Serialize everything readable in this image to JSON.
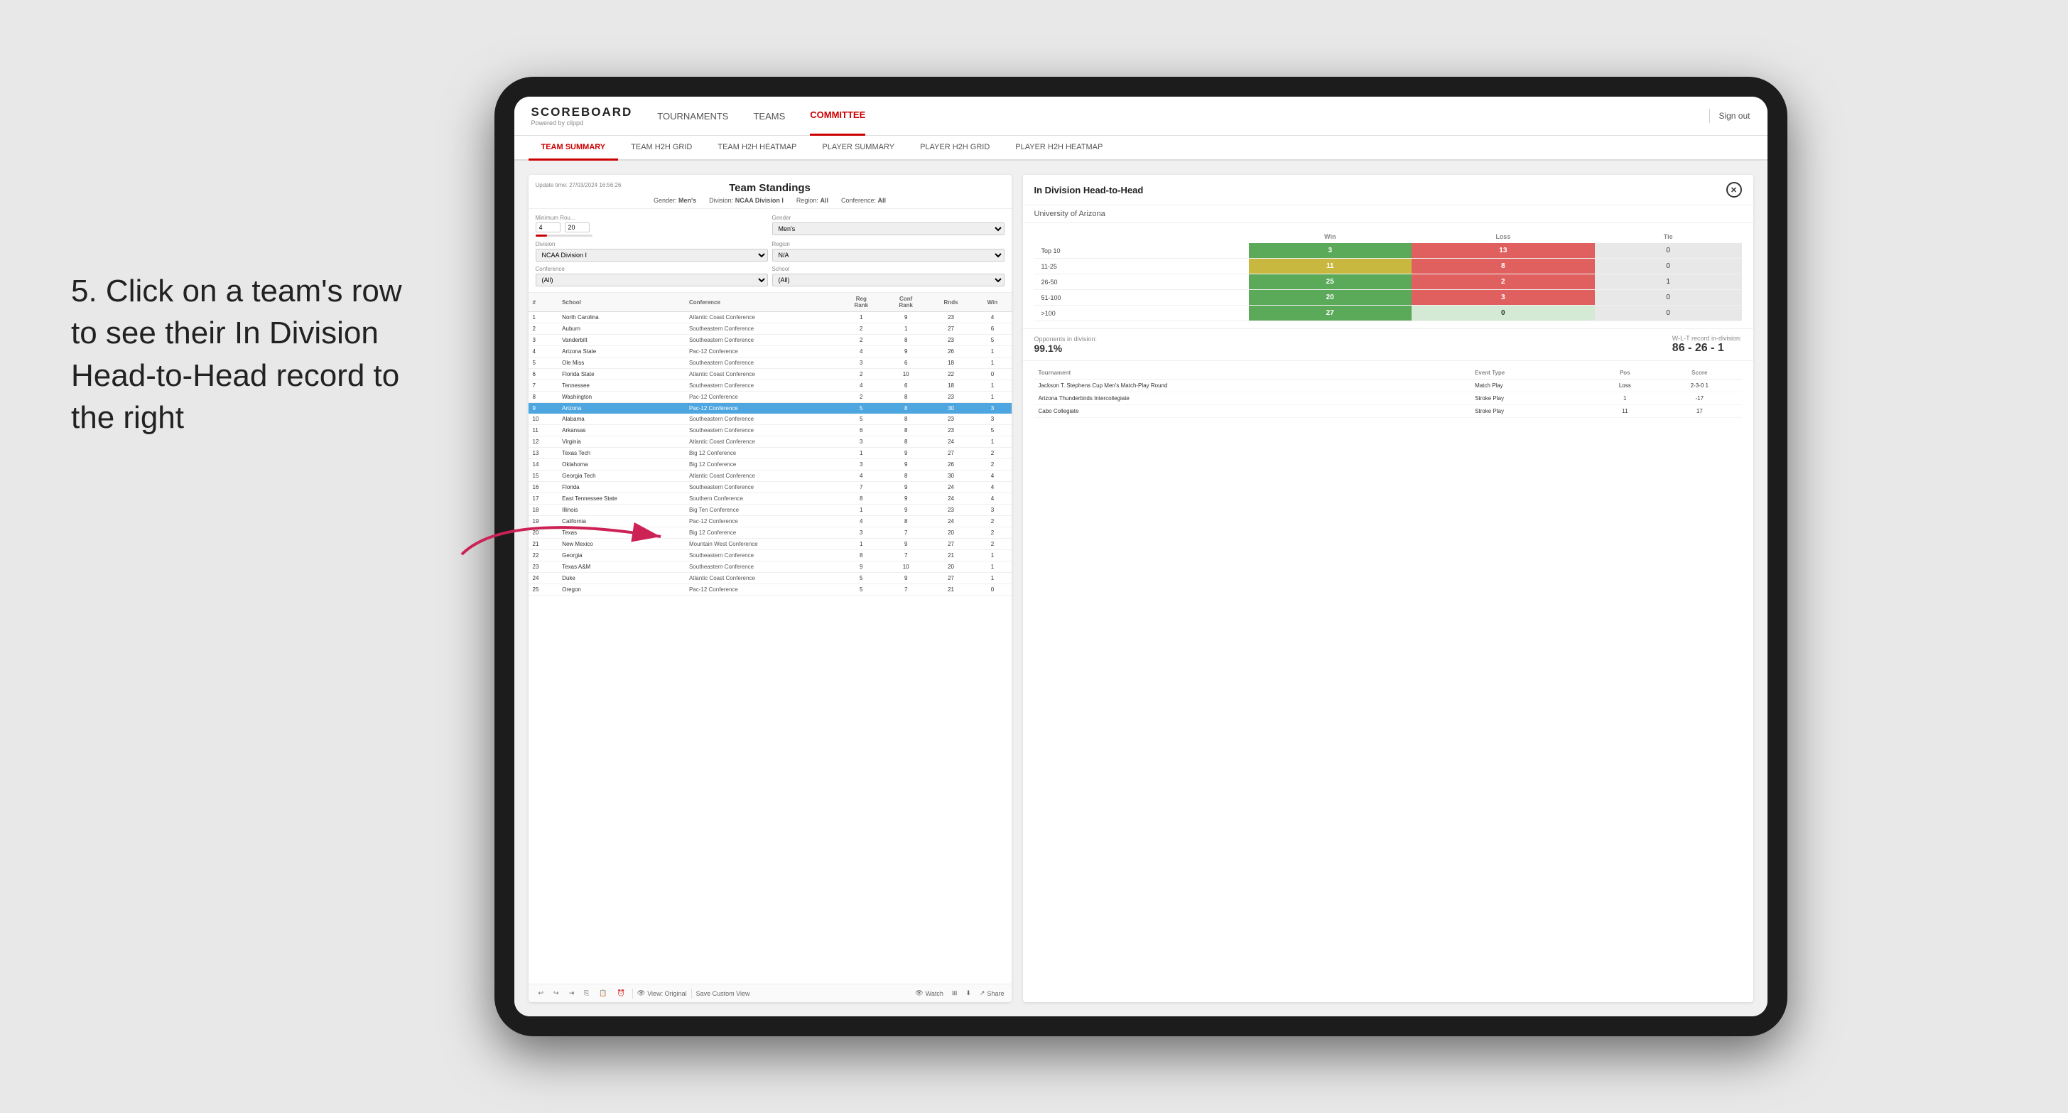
{
  "app": {
    "logo": "SCOREBOARD",
    "logo_sub": "Powered by clippd",
    "sign_out": "Sign out"
  },
  "nav": {
    "items": [
      {
        "label": "TOURNAMENTS",
        "active": false
      },
      {
        "label": "TEAMS",
        "active": false
      },
      {
        "label": "COMMITTEE",
        "active": true
      }
    ]
  },
  "sub_nav": {
    "items": [
      {
        "label": "TEAM SUMMARY",
        "active": true
      },
      {
        "label": "TEAM H2H GRID",
        "active": false
      },
      {
        "label": "TEAM H2H HEATMAP",
        "active": false
      },
      {
        "label": "PLAYER SUMMARY",
        "active": false
      },
      {
        "label": "PLAYER H2H GRID",
        "active": false
      },
      {
        "label": "PLAYER H2H HEATMAP",
        "active": false
      }
    ]
  },
  "annotation": "5. Click on a team's row to see their In Division Head-to-Head record to the right",
  "standings": {
    "title": "Team Standings",
    "update_time": "Update time: 27/03/2024 16:56:26",
    "gender_label": "Gender:",
    "gender_value": "Men's",
    "division_label": "Division:",
    "division_value": "NCAA Division I",
    "region_label": "Region:",
    "region_value": "All",
    "conference_label": "Conference:",
    "conference_value": "All",
    "min_rounds_label": "Minimum Rou...",
    "min_rounds_value": "4",
    "min_rounds_max": "20",
    "gender_filter": "Men's",
    "division_filter": "NCAA Division I",
    "region_filter": "N/A",
    "conference_filter": "(All)",
    "school_filter": "(All)",
    "columns": [
      "#",
      "School",
      "Conference",
      "Reg Rank",
      "Conf Rank",
      "Rnds",
      "Win"
    ],
    "rows": [
      {
        "num": 1,
        "school": "North Carolina",
        "conference": "Atlantic Coast Conference",
        "reg_rank": 1,
        "conf_rank": 9,
        "rnds": 23,
        "win": 4
      },
      {
        "num": 2,
        "school": "Auburn",
        "conference": "Southeastern Conference",
        "reg_rank": 2,
        "conf_rank": 1,
        "rnds": 27,
        "win": 6
      },
      {
        "num": 3,
        "school": "Vanderbilt",
        "conference": "Southeastern Conference",
        "reg_rank": 2,
        "conf_rank": 8,
        "rnds": 23,
        "win": 5
      },
      {
        "num": 4,
        "school": "Arizona State",
        "conference": "Pac-12 Conference",
        "reg_rank": 4,
        "conf_rank": 9,
        "rnds": 26,
        "win": 1
      },
      {
        "num": 5,
        "school": "Ole Miss",
        "conference": "Southeastern Conference",
        "reg_rank": 3,
        "conf_rank": 6,
        "rnds": 18,
        "win": 1
      },
      {
        "num": 6,
        "school": "Florida State",
        "conference": "Atlantic Coast Conference",
        "reg_rank": 2,
        "conf_rank": 10,
        "rnds": 22,
        "win": 0
      },
      {
        "num": 7,
        "school": "Tennessee",
        "conference": "Southeastern Conference",
        "reg_rank": 4,
        "conf_rank": 6,
        "rnds": 18,
        "win": 1
      },
      {
        "num": 8,
        "school": "Washington",
        "conference": "Pac-12 Conference",
        "reg_rank": 2,
        "conf_rank": 8,
        "rnds": 23,
        "win": 1
      },
      {
        "num": 9,
        "school": "Arizona",
        "conference": "Pac-12 Conference",
        "reg_rank": 5,
        "conf_rank": 8,
        "rnds": 30,
        "win": 3,
        "highlighted": true
      },
      {
        "num": 10,
        "school": "Alabama",
        "conference": "Southeastern Conference",
        "reg_rank": 5,
        "conf_rank": 8,
        "rnds": 23,
        "win": 3
      },
      {
        "num": 11,
        "school": "Arkansas",
        "conference": "Southeastern Conference",
        "reg_rank": 6,
        "conf_rank": 8,
        "rnds": 23,
        "win": 5
      },
      {
        "num": 12,
        "school": "Virginia",
        "conference": "Atlantic Coast Conference",
        "reg_rank": 3,
        "conf_rank": 8,
        "rnds": 24,
        "win": 1
      },
      {
        "num": 13,
        "school": "Texas Tech",
        "conference": "Big 12 Conference",
        "reg_rank": 1,
        "conf_rank": 9,
        "rnds": 27,
        "win": 2
      },
      {
        "num": 14,
        "school": "Oklahoma",
        "conference": "Big 12 Conference",
        "reg_rank": 3,
        "conf_rank": 9,
        "rnds": 26,
        "win": 2
      },
      {
        "num": 15,
        "school": "Georgia Tech",
        "conference": "Atlantic Coast Conference",
        "reg_rank": 4,
        "conf_rank": 8,
        "rnds": 30,
        "win": 4
      },
      {
        "num": 16,
        "school": "Florida",
        "conference": "Southeastern Conference",
        "reg_rank": 7,
        "conf_rank": 9,
        "rnds": 24,
        "win": 4
      },
      {
        "num": 17,
        "school": "East Tennessee State",
        "conference": "Southern Conference",
        "reg_rank": 8,
        "conf_rank": 9,
        "rnds": 24,
        "win": 4
      },
      {
        "num": 18,
        "school": "Illinois",
        "conference": "Big Ten Conference",
        "reg_rank": 1,
        "conf_rank": 9,
        "rnds": 23,
        "win": 3
      },
      {
        "num": 19,
        "school": "California",
        "conference": "Pac-12 Conference",
        "reg_rank": 4,
        "conf_rank": 8,
        "rnds": 24,
        "win": 2
      },
      {
        "num": 20,
        "school": "Texas",
        "conference": "Big 12 Conference",
        "reg_rank": 3,
        "conf_rank": 7,
        "rnds": 20,
        "win": 2
      },
      {
        "num": 21,
        "school": "New Mexico",
        "conference": "Mountain West Conference",
        "reg_rank": 1,
        "conf_rank": 9,
        "rnds": 27,
        "win": 2
      },
      {
        "num": 22,
        "school": "Georgia",
        "conference": "Southeastern Conference",
        "reg_rank": 8,
        "conf_rank": 7,
        "rnds": 21,
        "win": 1
      },
      {
        "num": 23,
        "school": "Texas A&M",
        "conference": "Southeastern Conference",
        "reg_rank": 9,
        "conf_rank": 10,
        "rnds": 20,
        "win": 1
      },
      {
        "num": 24,
        "school": "Duke",
        "conference": "Atlantic Coast Conference",
        "reg_rank": 5,
        "conf_rank": 9,
        "rnds": 27,
        "win": 1
      },
      {
        "num": 25,
        "school": "Oregon",
        "conference": "Pac-12 Conference",
        "reg_rank": 5,
        "conf_rank": 7,
        "rnds": 21,
        "win": 0
      }
    ]
  },
  "h2h": {
    "title": "In Division Head-to-Head",
    "team": "University of Arizona",
    "win_label": "Win",
    "loss_label": "Loss",
    "tie_label": "Tie",
    "rows": [
      {
        "label": "Top 10",
        "win": 3,
        "loss": 13,
        "tie": 0,
        "win_color": "green",
        "loss_color": "red"
      },
      {
        "label": "11-25",
        "win": 11,
        "loss": 8,
        "tie": 0,
        "win_color": "yellow",
        "loss_color": "light"
      },
      {
        "label": "26-50",
        "win": 25,
        "loss": 2,
        "tie": 1,
        "win_color": "green",
        "loss_color": "light"
      },
      {
        "label": "51-100",
        "win": 20,
        "loss": 3,
        "tie": 0,
        "win_color": "green",
        "loss_color": "light"
      },
      {
        "label": ">100",
        "win": 27,
        "loss": 0,
        "tie": 0,
        "win_color": "green",
        "loss_color": "light"
      }
    ],
    "opponents_label": "Opponents in division:",
    "opponents_value": "99.1%",
    "record_label": "W-L-T record in-division:",
    "record_value": "86 - 26 - 1",
    "tournaments": [
      {
        "name": "Jackson T. Stephens Cup Men's Match-Play Round",
        "event_type": "Match Play",
        "pos": "Loss",
        "score": "2-3-0 1"
      },
      {
        "name": "Arizona Thunderbirds Intercollegiate",
        "event_type": "Stroke Play",
        "pos": "1",
        "score": "-17"
      },
      {
        "name": "Cabo Collegiate",
        "event_type": "Stroke Play",
        "pos": "11",
        "score": "17"
      }
    ],
    "tournament_cols": [
      "Tournament",
      "Event Type",
      "Pos",
      "Score"
    ]
  },
  "toolbar": {
    "view_original": "View: Original",
    "save_custom": "Save Custom View",
    "watch": "Watch",
    "share": "Share"
  }
}
